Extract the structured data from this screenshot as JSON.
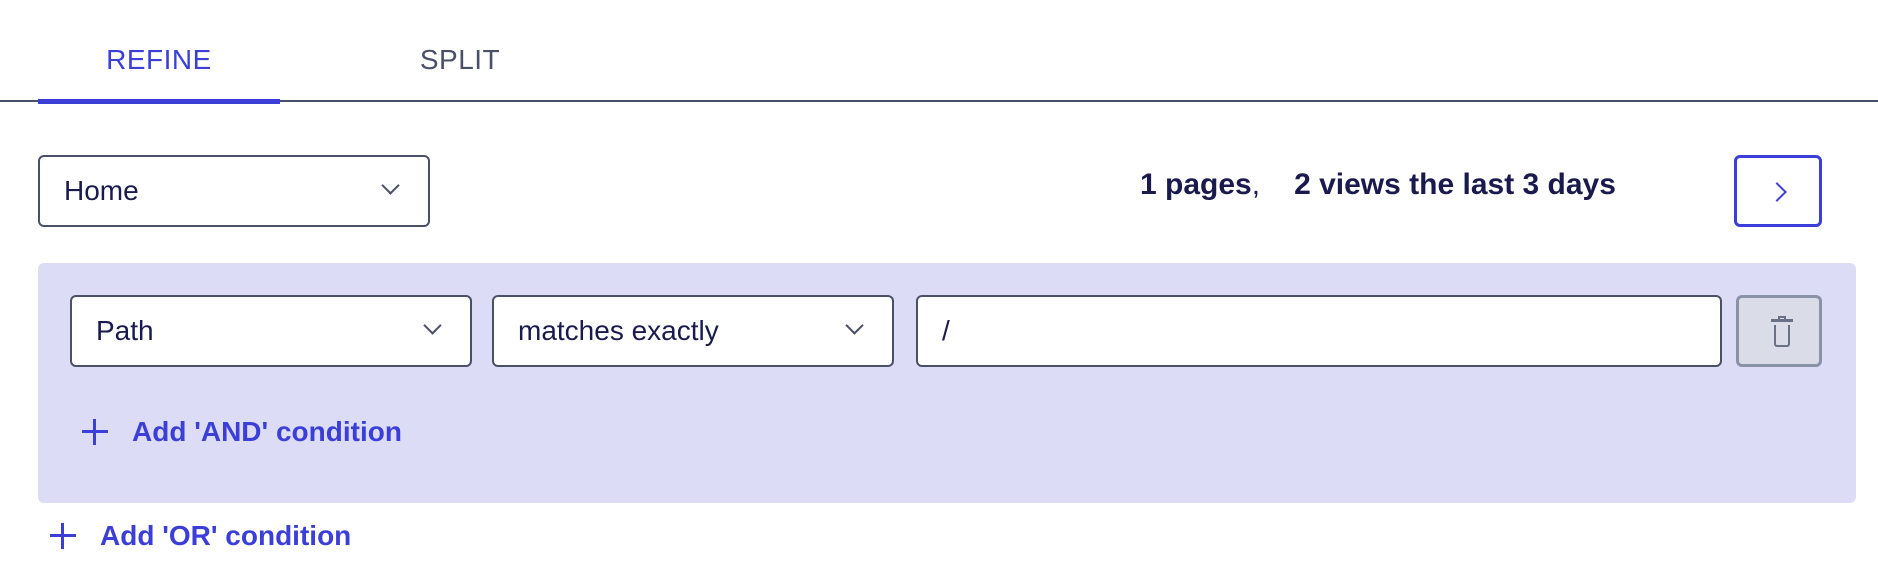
{
  "tabs": [
    {
      "label": "REFINE",
      "active": true
    },
    {
      "label": "SPLIT",
      "active": false
    }
  ],
  "page_select": {
    "value": "Home"
  },
  "stats": {
    "pages": "1 pages",
    "separator": ",",
    "views": "2 views the last 3 days"
  },
  "condition": {
    "field": "Path",
    "operator": "matches exactly",
    "value": "/"
  },
  "actions": {
    "add_and": "Add 'AND' condition",
    "add_or": "Add 'OR' condition"
  },
  "icons": {
    "next": "chevron-right-icon",
    "delete": "trash-icon",
    "add": "plus-icon",
    "dropdown": "chevron-down-icon"
  },
  "colors": {
    "accent": "#3b3fd8",
    "text": "#1a1a4e",
    "panel": "#dcdcf6",
    "border": "#4a5068"
  }
}
